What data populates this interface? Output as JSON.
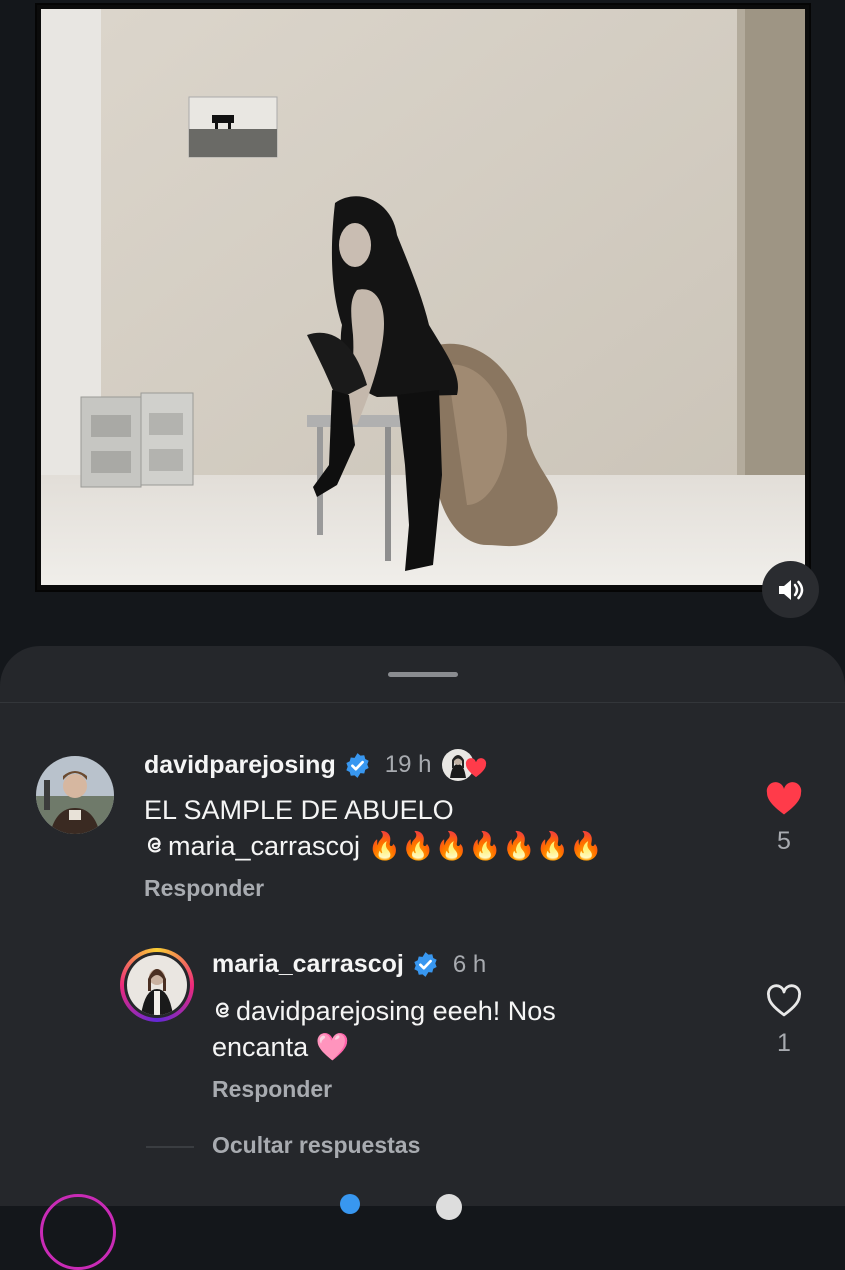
{
  "video": {
    "mute_icon": "speaker-on-icon"
  },
  "sheet": {
    "handle_icon": "drag-handle"
  },
  "comments": [
    {
      "username": "davidparejosing",
      "verified": true,
      "time": "19 h",
      "text_line1": "EL SAMPLE DE ABUELO",
      "mention": "maria_carrascoj",
      "fires": "🔥🔥🔥🔥🔥🔥🔥",
      "reply_label": "Responder",
      "likes": "5",
      "liked": true,
      "liked_by_creator": true
    },
    {
      "username": "maria_carrascoj",
      "verified": true,
      "time": "6 h",
      "mention": "davidparejosing",
      "text_rest": "eeeh! Nos",
      "text_line2": "encanta",
      "emoji": "🩷",
      "reply_label": "Responder",
      "likes": "1",
      "liked": false
    }
  ],
  "hide_replies_label": "Ocultar respuestas",
  "colors": {
    "background": "#14171b",
    "sheet": "#25272b",
    "heart_liked": "#ff3b4a",
    "verified": "#3897f0",
    "muted_text": "#a8abb0"
  }
}
